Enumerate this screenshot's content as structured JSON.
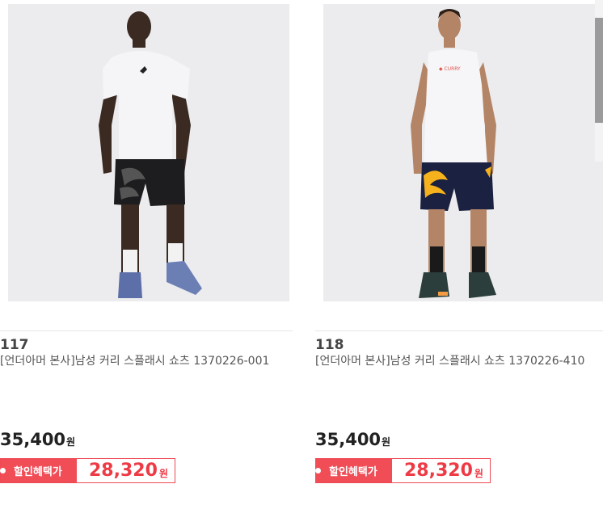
{
  "products": [
    {
      "number": "117",
      "name": "[언더아머 본사]남성 커리 스플래시 쇼츠 1370226-001",
      "price": "35,400",
      "price_unit": "원",
      "discount_label": "할인혜택가",
      "sale_price": "28,320",
      "sale_unit": "원"
    },
    {
      "number": "118",
      "name": "[언더아머 본사]남성 커리 스플래시 쇼츠 1370226-410",
      "price": "35,400",
      "price_unit": "원",
      "discount_label": "할인혜택가",
      "sale_price": "28,320",
      "sale_unit": "원"
    }
  ],
  "images": [
    {
      "icon": "product-photo-model-white-tee-black-shorts"
    },
    {
      "icon": "product-photo-model-white-tank-navy-shorts"
    }
  ]
}
